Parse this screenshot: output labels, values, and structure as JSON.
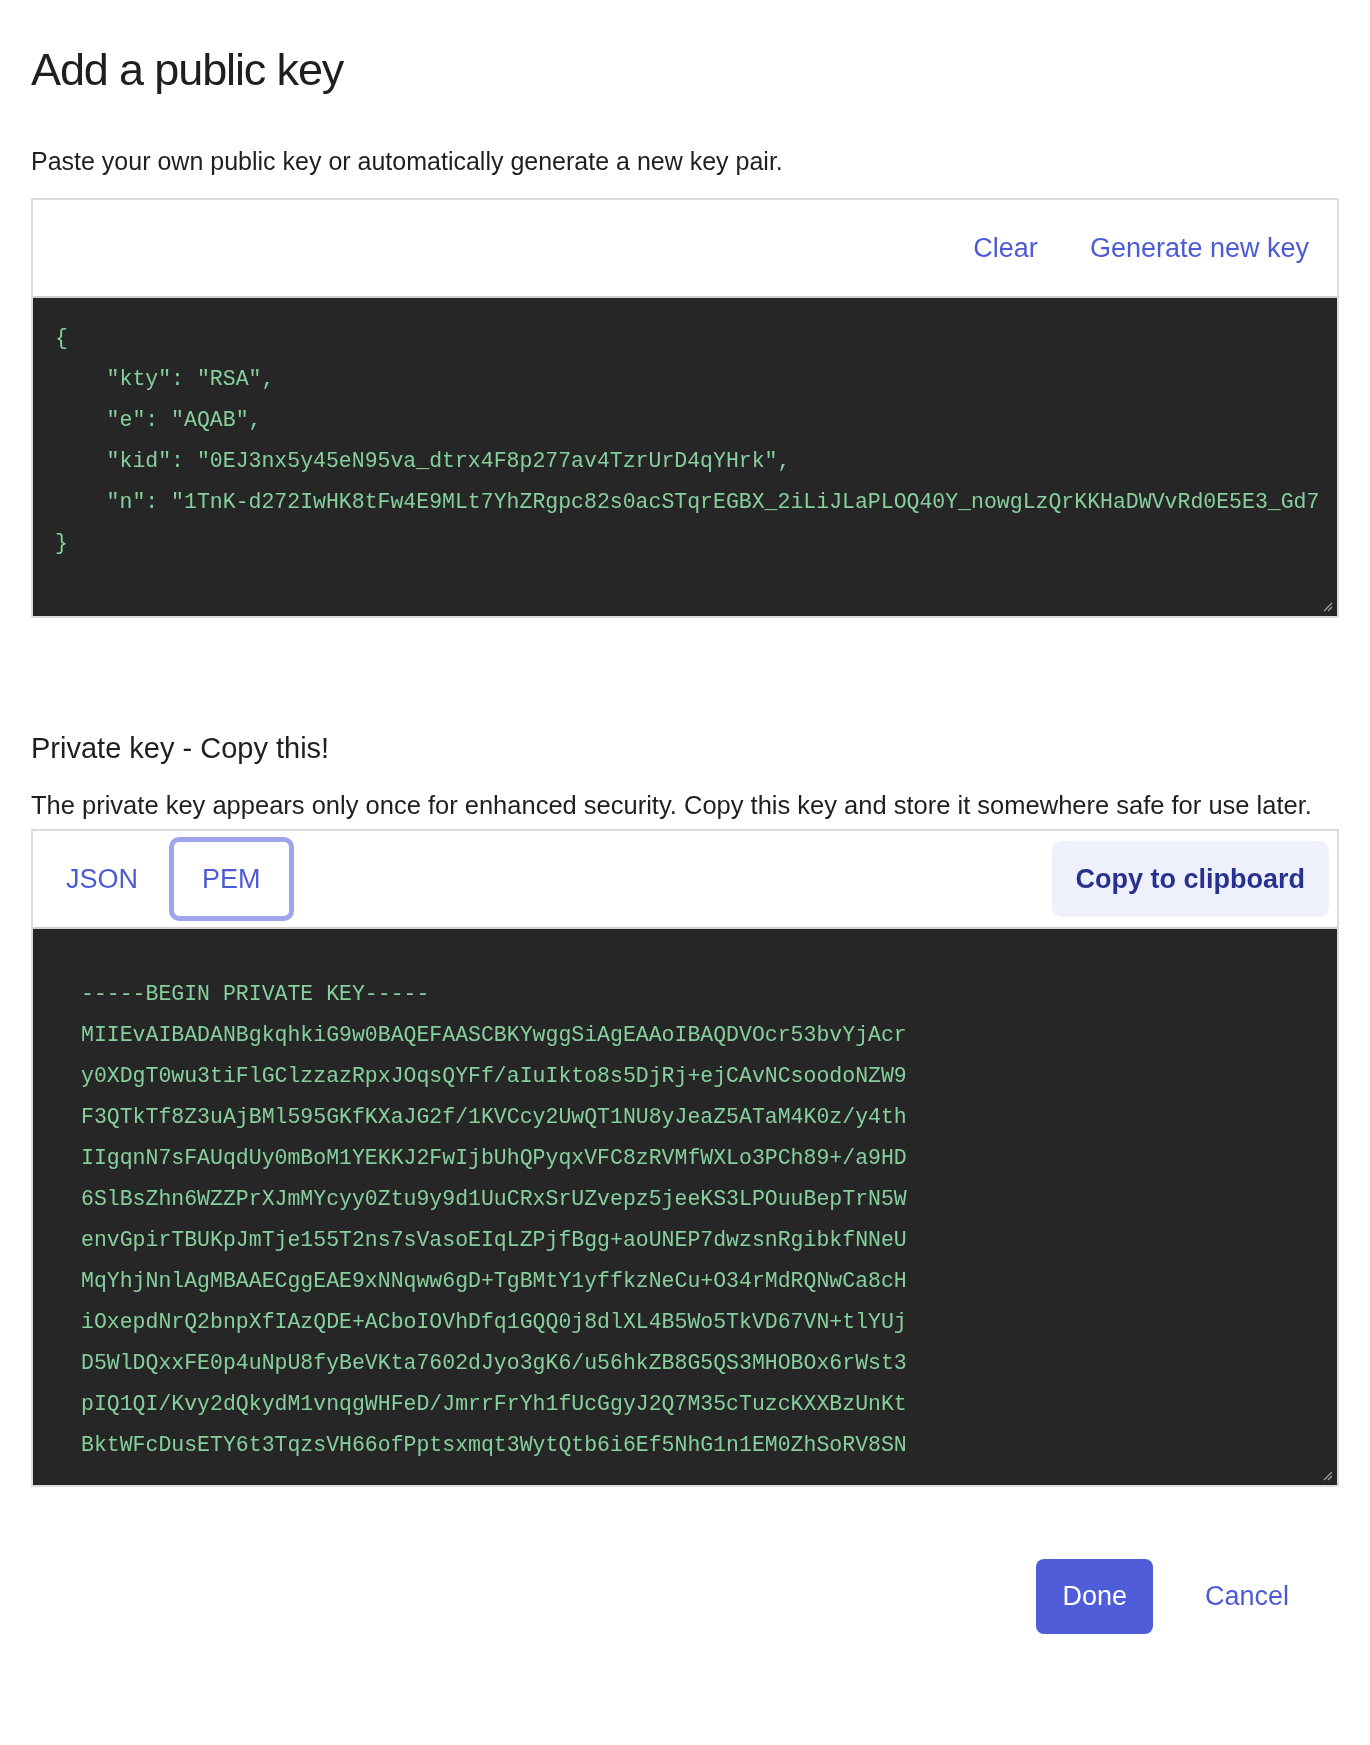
{
  "title": "Add a public key",
  "intro": "Paste your own public key or automatically generate a new key pair.",
  "public_key": {
    "actions": [
      "Clear",
      "Generate new key"
    ],
    "lines": [
      "{",
      "    \"kty\": \"RSA\",",
      "    \"e\": \"AQAB\",",
      "    \"kid\": \"0EJ3nx5y45eN95va_dtrx4F8p277av4TzrUrD4qYHrk\",",
      "    \"n\": \"1TnK-d272IwHK8tFw4E9MLt7YhZRgpc82s0acSTqrEGBX_2iLiJLaPLOQ40Y_nowgLzQrKKHaDWVvRd0E5E3_Gd7",
      "}"
    ]
  },
  "private_key": {
    "heading": "Private key - Copy this!",
    "description": "The private key appears only once for enhanced security. Copy this key and store it somewhere safe for use later.",
    "tabs": [
      {
        "label": "JSON",
        "selected": false
      },
      {
        "label": "PEM",
        "selected": true
      }
    ],
    "copy_button": "Copy to clipboard",
    "lines": [
      "-----BEGIN PRIVATE KEY-----",
      "MIIEvAIBADANBgkqhkiG9w0BAQEFAASCBKYwggSiAgEAAoIBAQDVOcr53bvYjAcr",
      "y0XDgT0wu3tiFlGClzzazRpxJOqsQYFf/aIuIkto8s5DjRj+ejCAvNCsoodoNZW9",
      "F3QTkTf8Z3uAjBMl595GKfKXaJG2f/1KVCcy2UwQT1NU8yJeaZ5ATaM4K0z/y4th",
      "IIgqnN7sFAUqdUy0mBoM1YEKKJ2FwIjbUhQPyqxVFC8zRVMfWXLo3PCh89+/a9HD",
      "6SlBsZhn6WZZPrXJmMYcyy0Ztu9y9d1UuCRxSrUZvepz5jeeKS3LPOuuBepTrN5W",
      "envGpirTBUKpJmTje155T2ns7sVasoEIqLZPjfBgg+aoUNEP7dwzsnRgibkfNNeU",
      "MqYhjNnlAgMBAAECggEAE9xNNqww6gD+TgBMtY1yffkzNeCu+O34rMdRQNwCa8cH",
      "iOxepdNrQ2bnpXfIAzQDE+ACboIOVhDfq1GQQ0j8dlXL4B5Wo5TkVD67VN+tlYUj",
      "D5WlDQxxFE0p4uNpU8fyBeVKta7602dJyo3gK6/u56hkZB8G5QS3MHOBOx6rWst3",
      "pIQ1QI/Kvy2dQkydM1vnqgWHFeD/JmrrFrYh1fUcGgyJ2Q7M35cTuzcKXXBzUnKt",
      "BktWFcDusETY6t3TqzsVH66ofPptsxmqt3WytQtb6i6Ef5NhG1n1EM0ZhSoRV8SN"
    ]
  },
  "buttons": [
    {
      "kind": "primary",
      "label": "Done"
    },
    {
      "kind": "link",
      "label": "Cancel"
    }
  ]
}
